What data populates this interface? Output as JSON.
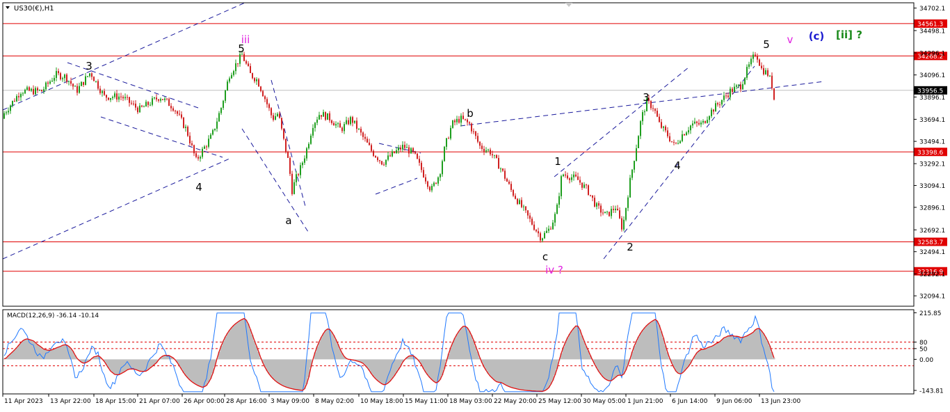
{
  "chart_data": {
    "type": "candlestick",
    "symbol_label": "US30(€),H1",
    "main_panel": {
      "ylim": [
        32000,
        34750
      ],
      "y_ticks": [
        "34702.1",
        "34498.1",
        "34296.1",
        "34096.1",
        "33896.1",
        "33694.1",
        "33494.1",
        "33292.1",
        "33094.1",
        "32896.1",
        "32692.1",
        "32494.1",
        "32292.1",
        "32094.1"
      ],
      "horizontal_levels": [
        {
          "label": "34561.3",
          "value": 34561.3
        },
        {
          "label": "34268.2",
          "value": 34268.2
        },
        {
          "label": "33398.6",
          "value": 33398.6
        },
        {
          "label": "32583.7",
          "value": 32583.7
        },
        {
          "label": "32316.9",
          "value": 32316.9
        }
      ],
      "current_price": {
        "label": "33956.5",
        "value": 33956.5
      },
      "price_path": [
        [
          0,
          33700
        ],
        [
          30,
          33950
        ],
        [
          60,
          33950
        ],
        [
          80,
          34100
        ],
        [
          95,
          34080
        ],
        [
          110,
          33950
        ],
        [
          130,
          34120
        ],
        [
          150,
          33900
        ],
        [
          175,
          33900
        ],
        [
          200,
          33780
        ],
        [
          230,
          33900
        ],
        [
          250,
          33800
        ],
        [
          268,
          33600
        ],
        [
          282,
          33320
        ],
        [
          295,
          33450
        ],
        [
          305,
          33550
        ],
        [
          318,
          33800
        ],
        [
          330,
          34100
        ],
        [
          348,
          34280
        ],
        [
          360,
          34100
        ],
        [
          370,
          34050
        ],
        [
          380,
          33900
        ],
        [
          392,
          33700
        ],
        [
          400,
          33750
        ],
        [
          408,
          33500
        ],
        [
          415,
          33300
        ],
        [
          420,
          33050
        ],
        [
          425,
          33150
        ],
        [
          432,
          33250
        ],
        [
          440,
          33400
        ],
        [
          450,
          33650
        ],
        [
          460,
          33750
        ],
        [
          475,
          33700
        ],
        [
          490,
          33600
        ],
        [
          505,
          33700
        ],
        [
          520,
          33550
        ],
        [
          535,
          33400
        ],
        [
          550,
          33300
        ],
        [
          565,
          33380
        ],
        [
          580,
          33450
        ],
        [
          595,
          33380
        ],
        [
          605,
          33250
        ],
        [
          620,
          33050
        ],
        [
          632,
          33200
        ],
        [
          640,
          33450
        ],
        [
          650,
          33650
        ],
        [
          662,
          33700
        ],
        [
          675,
          33650
        ],
        [
          690,
          33450
        ],
        [
          705,
          33400
        ],
        [
          720,
          33250
        ],
        [
          735,
          33050
        ],
        [
          750,
          32900
        ],
        [
          765,
          32750
        ],
        [
          778,
          32620
        ],
        [
          790,
          32700
        ],
        [
          800,
          32850
        ],
        [
          808,
          33200
        ],
        [
          818,
          33180
        ],
        [
          830,
          33150
        ],
        [
          845,
          33050
        ],
        [
          858,
          32900
        ],
        [
          872,
          32820
        ],
        [
          885,
          32900
        ],
        [
          895,
          32700
        ],
        [
          905,
          33100
        ],
        [
          915,
          33450
        ],
        [
          922,
          33700
        ],
        [
          930,
          33850
        ],
        [
          940,
          33800
        ],
        [
          948,
          33650
        ],
        [
          960,
          33550
        ],
        [
          970,
          33450
        ],
        [
          980,
          33550
        ],
        [
          995,
          33650
        ],
        [
          1010,
          33650
        ],
        [
          1020,
          33750
        ],
        [
          1035,
          33850
        ],
        [
          1050,
          33950
        ],
        [
          1065,
          34000
        ],
        [
          1075,
          34150
        ],
        [
          1087,
          34300
        ],
        [
          1095,
          34150
        ],
        [
          1105,
          34100
        ],
        [
          1110,
          34000
        ],
        [
          1115,
          33800
        ]
      ],
      "wave_labels": [
        {
          "text": "3",
          "color": "#000000"
        },
        {
          "text": "4",
          "color": "#000000"
        },
        {
          "text": "5",
          "color": "#000000"
        },
        {
          "text": "iii",
          "color": "#e020e0"
        },
        {
          "text": "a",
          "color": "#000000"
        },
        {
          "text": "b",
          "color": "#000000"
        },
        {
          "text": "c",
          "color": "#000000"
        },
        {
          "text": "iv ?",
          "color": "#e020e0"
        },
        {
          "text": "1",
          "color": "#000000"
        },
        {
          "text": "2",
          "color": "#000000"
        },
        {
          "text": "3",
          "color": "#000000"
        },
        {
          "text": "4",
          "color": "#000000"
        },
        {
          "text": "5",
          "color": "#000000"
        },
        {
          "text": "v",
          "color": "#e020e0"
        },
        {
          "text": "(c)",
          "color": "#1a1ad0"
        },
        {
          "text": "[ii] ?",
          "color": "#1a8a1a"
        }
      ]
    },
    "macd_panel": {
      "label": "MACD(12,26,9) -36.14 -10.14",
      "ylim": [
        -160,
        230
      ],
      "y_ticks": [
        "215.85",
        "80",
        "50",
        "0.00",
        "-143.81"
      ],
      "dotted_levels": [
        80,
        50,
        -30
      ],
      "series_colors": {
        "histogram": "#bdbdbd",
        "main": "#1e78ff",
        "signal": "#e01010"
      }
    },
    "x_ticks": [
      "11 Apr 2023",
      "13 Apr 22:00",
      "18 Apr 15:00",
      "21 Apr 07:00",
      "26 Apr 00:00",
      "28 Apr 16:00",
      "3 May 09:00",
      "8 May 02:00",
      "10 May 18:00",
      "15 May 11:00",
      "18 May 03:00",
      "22 May 20:00",
      "25 May 12:00",
      "30 May 05:00",
      "1 Jun 21:00",
      "6 Jun 14:00",
      "9 Jun 06:00",
      "13 Jun 23:00"
    ],
    "colors": {
      "bull": "#1e9e1e",
      "bear": "#d02020",
      "level_line": "#e00000",
      "trendline": "#1a1a9c",
      "axis_text": "#000000",
      "price_label_bg": "#e00000",
      "current_label_bg": "#000000"
    }
  }
}
